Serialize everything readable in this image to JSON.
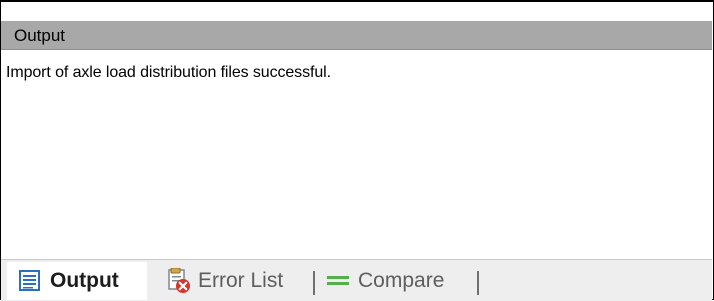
{
  "panel": {
    "title": "Output",
    "message": "Import of axle load distribution files successful."
  },
  "tabs": [
    {
      "label": "Output",
      "icon": "output-log-icon",
      "active": true
    },
    {
      "label": "Error List",
      "icon": "error-list-icon",
      "active": false
    },
    {
      "label": "Compare",
      "icon": "compare-icon",
      "active": false
    }
  ],
  "colors": {
    "title_bar": "#a8a8a8",
    "tab_bar": "#eeeeee",
    "output_icon_blue": "#2b6fbf",
    "error_red": "#d9332c",
    "compare_green": "#55b04a"
  }
}
